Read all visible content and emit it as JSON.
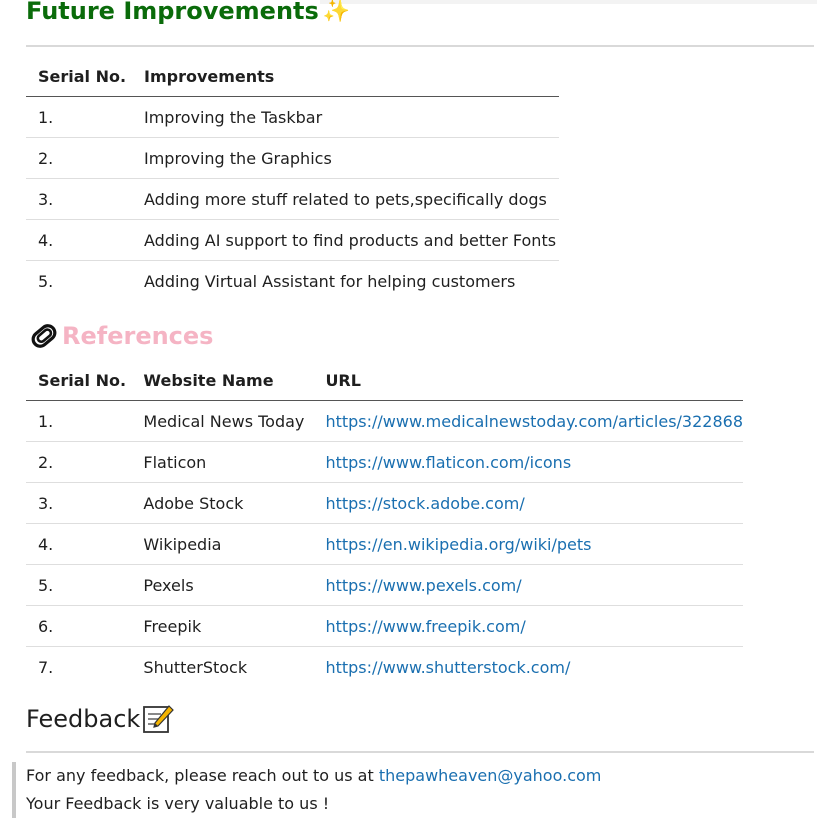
{
  "future": {
    "title": "Future Improvements",
    "headers": [
      "Serial No.",
      "Improvements"
    ],
    "rows": [
      [
        "1.",
        "Improving the Taskbar"
      ],
      [
        "2.",
        "Improving the Graphics"
      ],
      [
        "3.",
        "Adding more stuff related to pets,specifically dogs"
      ],
      [
        "4.",
        "Adding AI support to find products and better Fonts"
      ],
      [
        "5.",
        "Adding Virtual Assistant for helping customers"
      ]
    ]
  },
  "references": {
    "title": "References",
    "headers": [
      "Serial No.",
      "Website Name",
      "URL"
    ],
    "rows": [
      [
        "1.",
        "Medical News Today",
        "https://www.medicalnewstoday.com/articles/322868"
      ],
      [
        "2.",
        "Flaticon",
        "https://www.flaticon.com/icons"
      ],
      [
        "3.",
        "Adobe Stock",
        "https://stock.adobe.com/"
      ],
      [
        "4.",
        "Wikipedia",
        "https://en.wikipedia.org/wiki/pets"
      ],
      [
        "5.",
        "Pexels",
        "https://www.pexels.com/"
      ],
      [
        "6.",
        "Freepik",
        "https://www.freepik.com/"
      ],
      [
        "7.",
        "ShutterStock",
        "https://www.shutterstock.com/"
      ]
    ]
  },
  "feedback": {
    "title": "Feedback",
    "line1_prefix": "For any feedback, please reach out to us at ",
    "email": "thepawheaven@yahoo.com",
    "line2": "Your Feedback is very valuable to us !"
  },
  "icons": {
    "future": "sparkles-icon",
    "references": "paperclip-icon",
    "feedback": "memo-icon"
  },
  "colors": {
    "future_heading": "#0a6b0a",
    "references_heading": "#f5b4c4",
    "link": "#1a6fb0"
  }
}
